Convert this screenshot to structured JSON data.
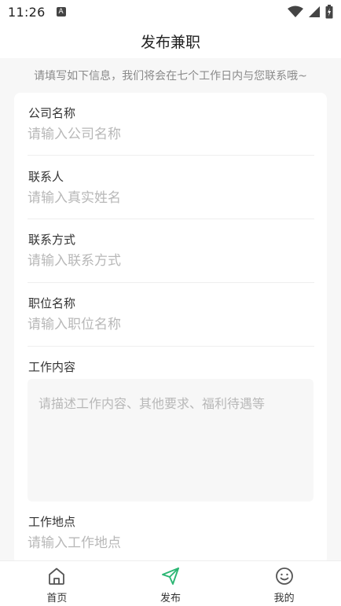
{
  "status": {
    "time": "11:26",
    "badge": "A"
  },
  "header": {
    "title": "发布兼职"
  },
  "notice": "请填写如下信息，我们将会在七个工作日内与您联系哦~",
  "form": {
    "company": {
      "label": "公司名称",
      "placeholder": "请输入公司名称",
      "value": ""
    },
    "contact": {
      "label": "联系人",
      "placeholder": "请输入真实姓名",
      "value": ""
    },
    "phone": {
      "label": "联系方式",
      "placeholder": "请输入联系方式",
      "value": ""
    },
    "position": {
      "label": "职位名称",
      "placeholder": "请输入职位名称",
      "value": ""
    },
    "content": {
      "label": "工作内容",
      "placeholder": "请描述工作内容、其他要求、福利待遇等",
      "value": ""
    },
    "location": {
      "label": "工作地点",
      "placeholder": "请输入工作地点",
      "value": ""
    }
  },
  "tabbar": {
    "items": [
      {
        "label": "首页",
        "icon": "home-icon",
        "active": false
      },
      {
        "label": "发布",
        "icon": "send-icon",
        "active": true
      },
      {
        "label": "我的",
        "icon": "smile-icon",
        "active": false
      }
    ],
    "active_color": "#2bb673",
    "inactive_color": "#555555"
  }
}
